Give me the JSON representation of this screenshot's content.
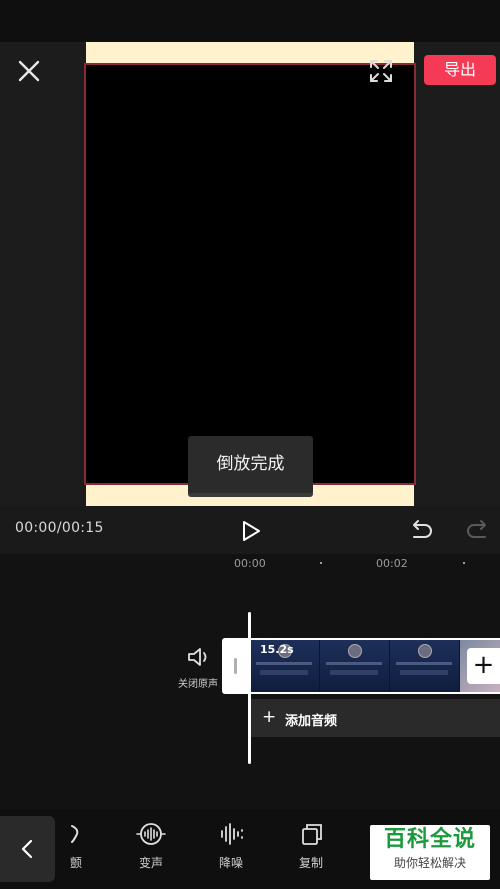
{
  "top_bar": {
    "export_label": "导出"
  },
  "preview": {
    "toast_text": "倒放完成"
  },
  "controls": {
    "time_display": "00:00/00:15"
  },
  "timeline": {
    "ruler_labels": [
      "00:00",
      "00:02"
    ],
    "mute_label": "关闭原声",
    "clip_duration": "15.2s",
    "add_audio_label": "添加音频"
  },
  "toolbar": {
    "items": [
      {
        "label": "颤",
        "icon": "cut-icon"
      },
      {
        "label": "变声",
        "icon": "voice-change-icon"
      },
      {
        "label": "降噪",
        "icon": "noise-reduction-icon"
      },
      {
        "label": "复制",
        "icon": "copy-icon"
      }
    ]
  },
  "watermark": {
    "title": "百科全说",
    "subtitle": "助你轻松解决"
  },
  "colors": {
    "accent": "#f43a54",
    "frame_border": "#8a2a35",
    "preview_bg": "#fff2cc"
  }
}
